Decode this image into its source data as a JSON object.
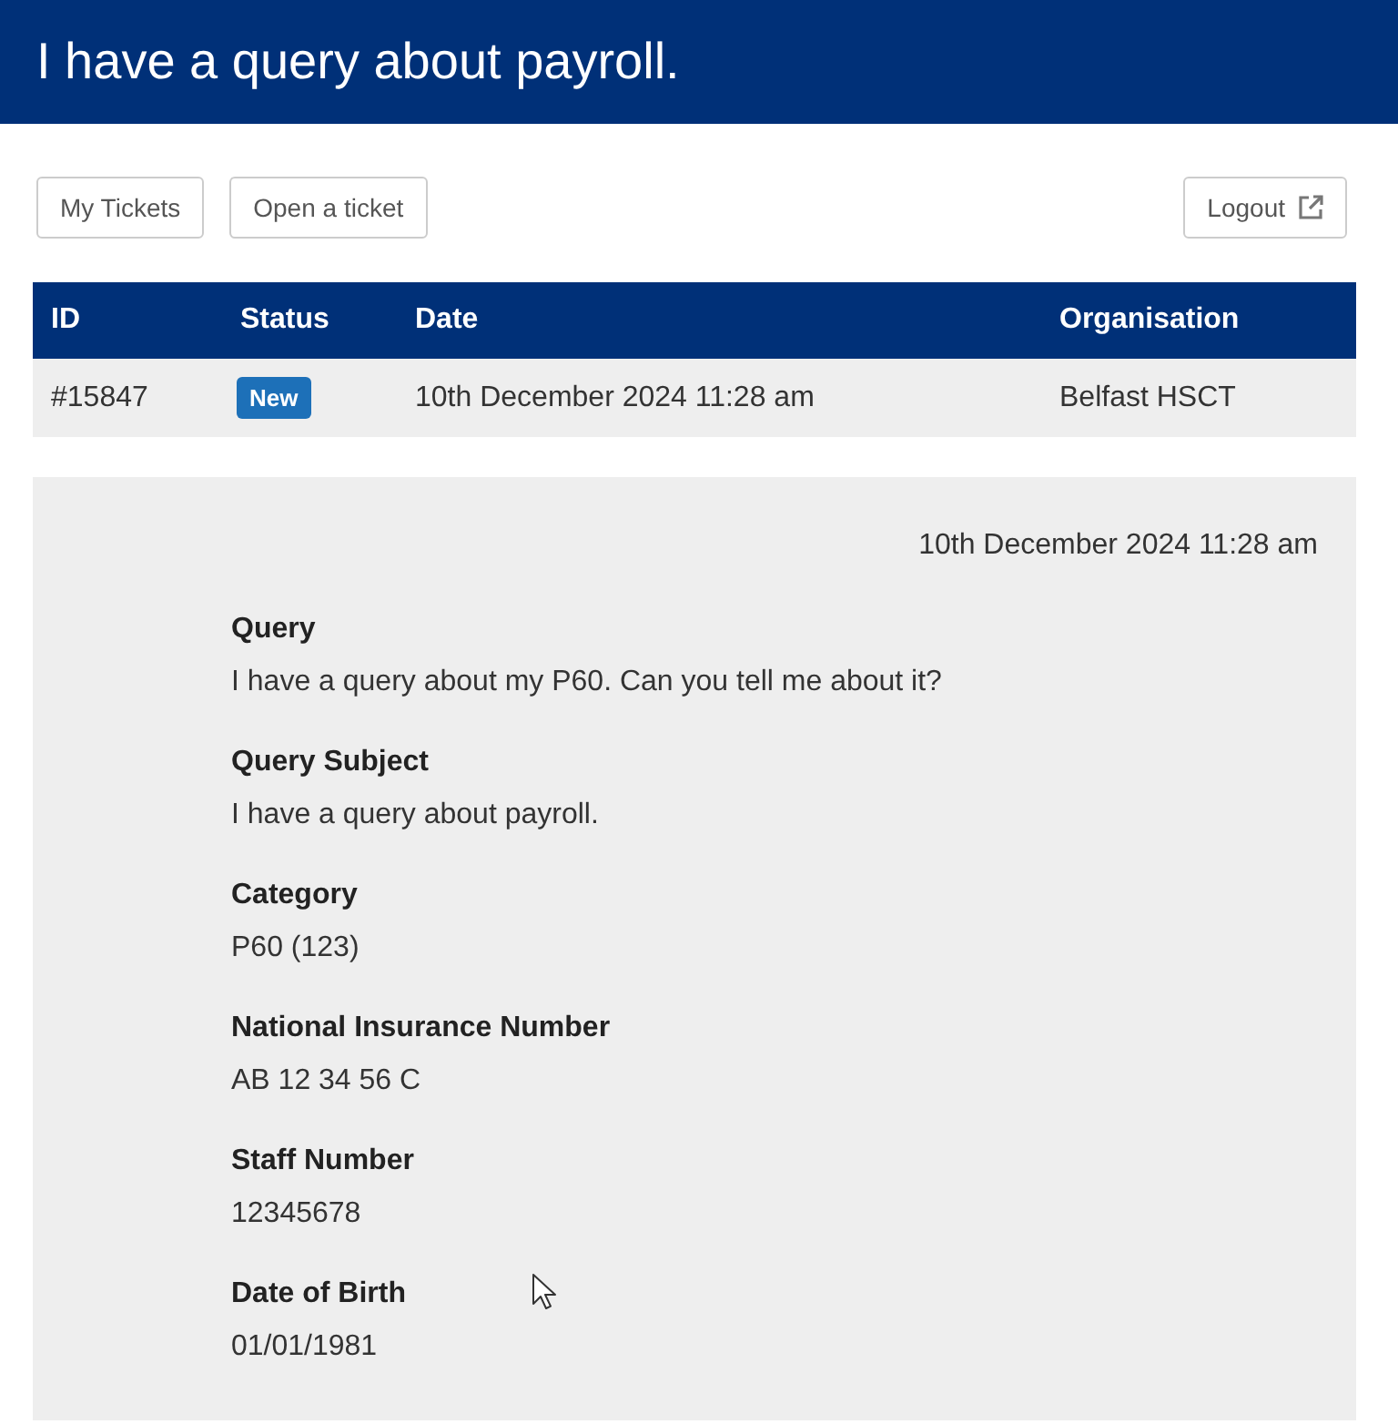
{
  "header": {
    "title": "I have a query about payroll."
  },
  "toolbar": {
    "buttons": [
      "My Tickets",
      "Open a ticket"
    ],
    "logout_button": "Logout"
  },
  "ticket_table": {
    "columns": [
      "ID",
      "Status",
      "Date",
      "Organisation"
    ],
    "rows": [
      {
        "id": "#15847",
        "status": "New",
        "date": "10th December 2024 11:28 am",
        "organisation": "Belfast HSCT"
      }
    ]
  },
  "ticket_detail": {
    "timestamp": "10th December 2024 11:28 am",
    "fields": [
      {
        "label": "Query",
        "value": "I have a query about my P60. Can you tell me about it?"
      },
      {
        "label": "Query Subject",
        "value": "I have a query about payroll."
      },
      {
        "label": "Category",
        "value": "P60 (123)"
      },
      {
        "label": "National Insurance Number",
        "value": "AB 12 34 56 C"
      },
      {
        "label": "Staff Number",
        "value": "12345678"
      },
      {
        "label": "Date of Birth",
        "value": "01/01/1981"
      }
    ]
  }
}
